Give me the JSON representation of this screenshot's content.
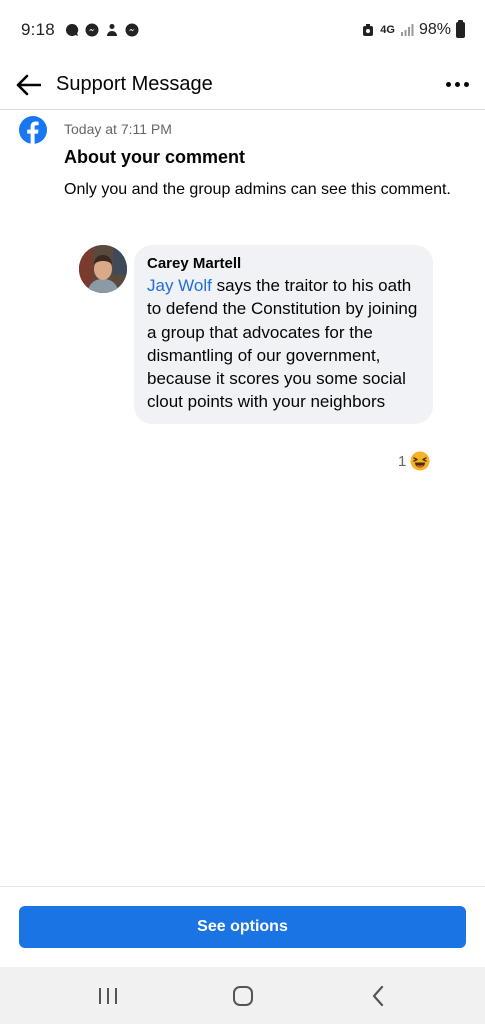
{
  "status_bar": {
    "time": "9:18",
    "network": "4G",
    "battery": "98%",
    "left_icons": [
      "signal-messenger-icon",
      "messenger-icon",
      "person-icon",
      "messenger-icon"
    ]
  },
  "header": {
    "title": "Support Message"
  },
  "message": {
    "timestamp": "Today at 7:11 PM",
    "title": "About your comment",
    "body": "Only you and the group admins can see this comment."
  },
  "comment": {
    "author": "Carey Martell",
    "mention": "Jay Wolf",
    "text": " says the traitor to his oath to defend the Constitution by joining a group that advocates for the dismantling of our government, because it scores you some social clout points with your neighbors",
    "reaction_count": "1",
    "reaction_icon": "laughing-emoji-icon"
  },
  "action": {
    "see_options_label": "See options"
  },
  "colors": {
    "facebook_blue": "#1877f2",
    "button_blue": "#1b74e4",
    "mention_blue": "#216fdb",
    "bubble_gray": "#f0f2f5"
  }
}
